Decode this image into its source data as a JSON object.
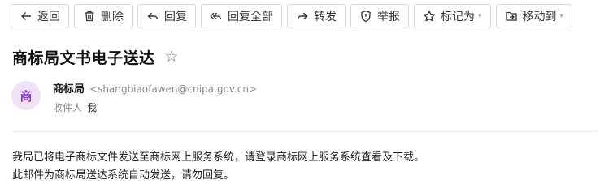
{
  "toolbar": {
    "back_label": "返回",
    "delete_label": "删除",
    "reply_label": "回复",
    "reply_all_label": "回复全部",
    "forward_label": "转发",
    "report_label": "举报",
    "mark_as_label": "标记为",
    "move_to_label": "移动到"
  },
  "email": {
    "subject": "商标局文书电子送达",
    "sender_avatar": "商",
    "sender_name": "商标局",
    "sender_email": "<shangbiaofawen@cnipa.gov.cn>",
    "recipient_label": "收件人",
    "recipient_value": "我",
    "body": [
      "我局已将电子商标文件发送至商标网上服务系统，请登录商标网上服务系统查看及下载。",
      "此邮件为商标局送达系统自动发送，请勿回复。"
    ]
  },
  "icons": {
    "back": "arrow-left-icon",
    "delete": "trash-icon",
    "reply": "reply-icon",
    "reply_all": "reply-all-icon",
    "forward": "forward-icon",
    "report": "shield-alert-icon",
    "mark_as": "star-outline-icon",
    "move_to": "folder-move-icon",
    "favorite": "star-outline-icon"
  },
  "colors": {
    "avatar_bg": "#efe2f6",
    "avatar_fg": "#8a3ab5",
    "muted_text": "#8a8a8a"
  }
}
